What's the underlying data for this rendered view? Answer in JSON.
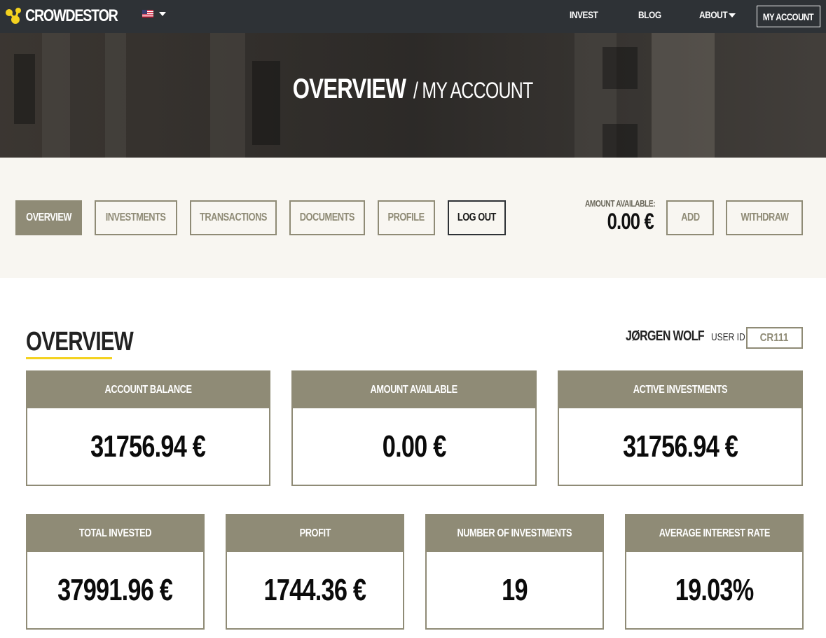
{
  "brand": {
    "name": "CROWDESTOR",
    "accent": "#f4d21f"
  },
  "topnav": {
    "language_icon": "us-flag-icon",
    "links": {
      "invest": "INVEST",
      "blog": "BLOG",
      "about": "ABOUT"
    },
    "my_account": "MY ACCOUNT"
  },
  "hero": {
    "title": "OVERVIEW",
    "subtitle": "/ MY ACCOUNT"
  },
  "tabs": {
    "overview": "OVERVIEW",
    "investments": "INVESTMENTS",
    "transactions": "TRANSACTIONS",
    "documents": "DOCUMENTS",
    "profile": "PROFILE",
    "logout": "LOG OUT"
  },
  "wallet": {
    "label": "AMOUNT AVAILABLE:",
    "value": "0.00 €",
    "add": "ADD",
    "withdraw": "WITHDRAW"
  },
  "overview": {
    "title": "OVERVIEW",
    "user_name": "JØRGEN WOLF",
    "user_id_label": "USER ID",
    "user_id": "CR111",
    "cards": {
      "account_balance": {
        "label": "ACCOUNT BALANCE",
        "value": "31756.94 €"
      },
      "amount_available": {
        "label": "AMOUNT AVAILABLE",
        "value": "0.00 €"
      },
      "active_investments": {
        "label": "ACTIVE INVESTMENTS",
        "value": "31756.94 €"
      },
      "total_invested": {
        "label": "TOTAL INVESTED",
        "value": "37991.96 €"
      },
      "profit": {
        "label": "PROFIT",
        "value": "1744.36 €"
      },
      "number_of_investments": {
        "label": "NUMBER OF INVESTMENTS",
        "value": "19"
      },
      "average_interest_rate": {
        "label": "AVERAGE INTEREST RATE",
        "value": "19.03%"
      }
    }
  },
  "colors": {
    "nav_bg": "#2e3236",
    "olive": "#8f8b76",
    "subnav_bg": "#f8f6f1"
  }
}
